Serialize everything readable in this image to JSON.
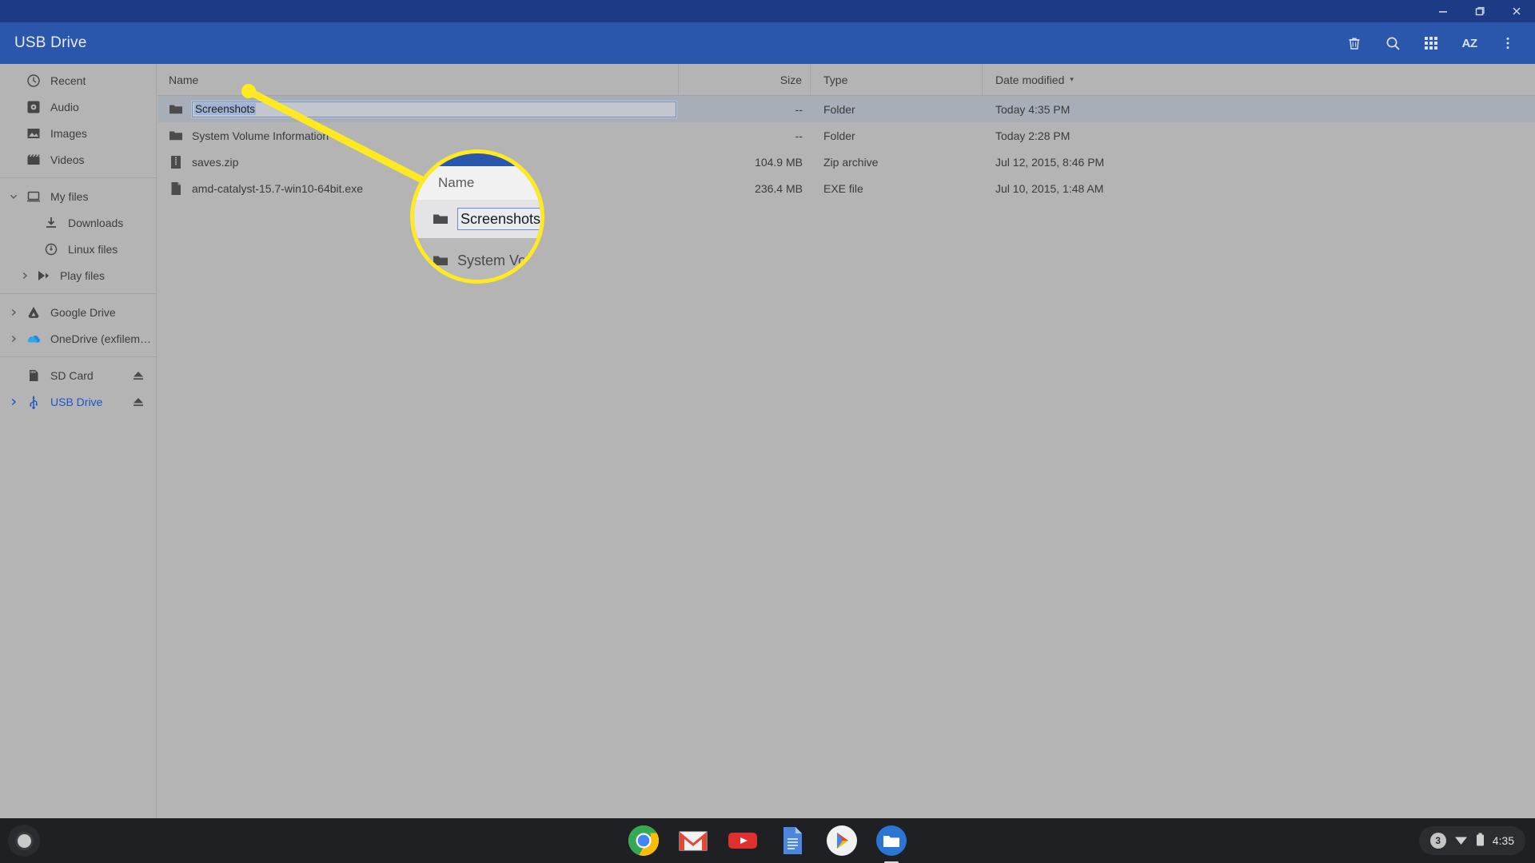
{
  "window": {
    "minimize_label": "Minimize",
    "restore_label": "Restore",
    "close_label": "Close"
  },
  "appbar": {
    "title": "USB Drive",
    "actions": [
      {
        "name": "delete-icon",
        "label": "Delete"
      },
      {
        "name": "search-icon",
        "label": "Search"
      },
      {
        "name": "grid-view-icon",
        "label": "Switch to grid view"
      },
      {
        "name": "sort-az-icon",
        "label": "AZ"
      },
      {
        "name": "more-menu-icon",
        "label": "More"
      }
    ]
  },
  "sidebar": {
    "items": [
      {
        "label": "Recent",
        "icon": "clock-icon",
        "indent": 0,
        "twisty": "",
        "active": false,
        "eject": false
      },
      {
        "label": "Audio",
        "icon": "audio-icon",
        "indent": 0,
        "twisty": "",
        "active": false,
        "eject": false
      },
      {
        "label": "Images",
        "icon": "image-icon",
        "indent": 0,
        "twisty": "",
        "active": false,
        "eject": false
      },
      {
        "label": "Videos",
        "icon": "video-icon",
        "indent": 0,
        "twisty": "",
        "active": false,
        "eject": false
      },
      {
        "label": "My files",
        "icon": "my-files-icon",
        "indent": 0,
        "twisty": "expanded",
        "active": false,
        "eject": false
      },
      {
        "label": "Downloads",
        "icon": "downloads-icon",
        "indent": 1,
        "twisty": "",
        "active": false,
        "eject": false
      },
      {
        "label": "Linux files",
        "icon": "linux-icon",
        "indent": 1,
        "twisty": "",
        "active": false,
        "eject": false
      },
      {
        "label": "Play files",
        "icon": "play-files-icon",
        "indent": 2,
        "twisty": "collapsed",
        "active": false,
        "eject": false
      },
      {
        "label": "Google Drive",
        "icon": "google-drive-icon",
        "indent": 0,
        "twisty": "collapsed",
        "active": false,
        "eject": false
      },
      {
        "label": "OneDrive (exfileme@outlook...",
        "icon": "onedrive-icon",
        "indent": 0,
        "twisty": "collapsed",
        "active": false,
        "eject": false
      },
      {
        "label": "SD Card",
        "icon": "sd-card-icon",
        "indent": 0,
        "twisty": "",
        "active": false,
        "eject": true
      },
      {
        "label": "USB Drive",
        "icon": "usb-icon",
        "indent": 0,
        "twisty": "collapsed",
        "active": true,
        "eject": true
      }
    ]
  },
  "filelist": {
    "columns": {
      "name": "Name",
      "size": "Size",
      "type": "Type",
      "date": "Date modified"
    },
    "sort_column": "date",
    "sort_caret": "▾",
    "rows": [
      {
        "name": "Screenshots",
        "icon": "folder-icon",
        "size": "--",
        "type": "Folder",
        "date": "Today 4:35 PM",
        "selected": true,
        "renaming": true
      },
      {
        "name": "System Volume Information",
        "icon": "folder-icon",
        "size": "--",
        "type": "Folder",
        "date": "Today 2:28 PM",
        "selected": false,
        "renaming": false
      },
      {
        "name": "saves.zip",
        "icon": "zip-icon",
        "size": "104.9 MB",
        "type": "Zip archive",
        "date": "Jul 12, 2015, 8:46 PM",
        "selected": false,
        "renaming": false
      },
      {
        "name": "amd-catalyst-15.7-win10-64bit.exe",
        "icon": "exe-icon",
        "size": "236.4 MB",
        "type": "EXE file",
        "date": "Jul 10, 2015, 1:48 AM",
        "selected": false,
        "renaming": false
      }
    ]
  },
  "magnifier": {
    "header": "Name",
    "row1_name": "Screenshots",
    "row2_name": "System Volu",
    "ring_color": "#ffe920"
  },
  "shelf": {
    "launcher_label": "Launcher",
    "apps": [
      {
        "name": "chrome-icon",
        "label": "Google Chrome",
        "running": false
      },
      {
        "name": "gmail-icon",
        "label": "Gmail",
        "running": false
      },
      {
        "name": "youtube-icon",
        "label": "YouTube",
        "running": false
      },
      {
        "name": "docs-icon",
        "label": "Google Docs",
        "running": false
      },
      {
        "name": "play-store-icon",
        "label": "Play Store",
        "running": false
      },
      {
        "name": "files-icon",
        "label": "Files",
        "running": true
      }
    ],
    "tray": {
      "notification_count": "3",
      "wifi": "wifi-icon",
      "battery": "battery-icon",
      "time": "4:35"
    }
  }
}
